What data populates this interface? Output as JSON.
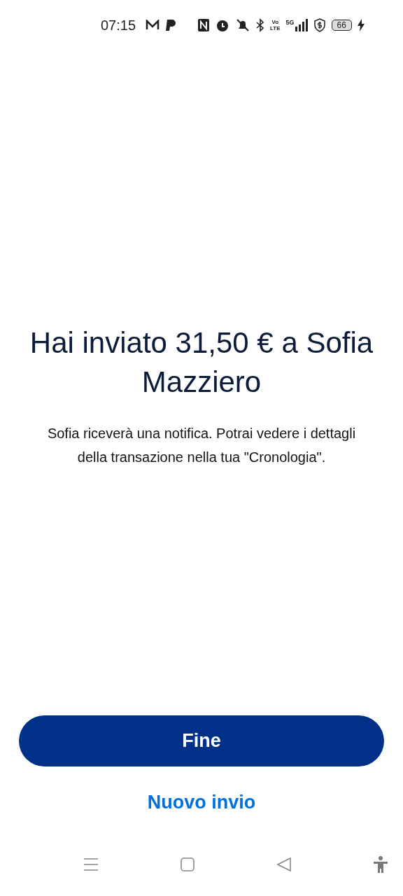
{
  "status_bar": {
    "time": "07:15",
    "volte": [
      "Vo",
      "LTE"
    ],
    "network": "5G",
    "battery": "66"
  },
  "title": "Hai inviato 31,50 € a Sofia Mazziero",
  "message": "Sofia riceverà una notifica. Potrai vedere i dettagli della transazione nella tua \"Cronologia\".",
  "primary_button": "Fine",
  "secondary_link": "Nuovo invio"
}
